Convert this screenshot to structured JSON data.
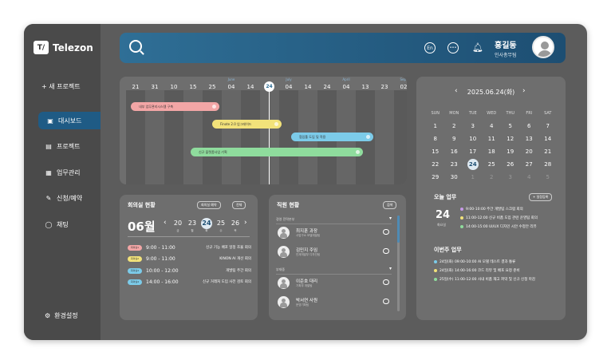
{
  "app": {
    "logo_mark": "T/",
    "name": "Telezon"
  },
  "sidebar": {
    "new_project": "+ 새 프로젝트",
    "items": [
      {
        "icon": "calendar-icon",
        "label": "대시보드",
        "active": true
      },
      {
        "icon": "folder-icon",
        "label": "프로젝트"
      },
      {
        "icon": "briefcase-icon",
        "label": "업무관리"
      },
      {
        "icon": "pencil-icon",
        "label": "신청/예약"
      },
      {
        "icon": "chat-icon",
        "label": "채팅"
      }
    ],
    "settings": "환경설정"
  },
  "topbar": {
    "lang": "En",
    "user_name": "홍길동",
    "user_role": "인사총무팀"
  },
  "gantt": {
    "dates": [
      "21",
      "31",
      "10",
      "15",
      "25",
      "04",
      "14",
      "24",
      "04",
      "14",
      "24",
      "04",
      "13",
      "23",
      "02",
      "12"
    ],
    "months": [
      "",
      "",
      "",
      "",
      "",
      "June",
      "",
      "",
      "July",
      "",
      "",
      "April",
      "",
      "",
      "Sept",
      ""
    ],
    "today_index": 7,
    "bars": [
      {
        "label": "내부 업무관리시스템 구축",
        "color": "#f3a6a6"
      },
      {
        "label": "Finote 2.0 업그레이드",
        "color": "#f2e27a"
      },
      {
        "label": "협업툴 도입 및 적용",
        "color": "#7ccbe9"
      },
      {
        "label": "신규 플랫폼사업 기획",
        "color": "#8fdc9d"
      }
    ]
  },
  "meeting": {
    "title": "회의실 현황",
    "reserve_btn": "회의실 예약",
    "view_btn": "전체",
    "month": "06월",
    "week": [
      {
        "d": "20",
        "w": "금"
      },
      {
        "d": "23",
        "w": "월"
      },
      {
        "d": "24",
        "w": "화"
      },
      {
        "d": "25",
        "w": "수"
      },
      {
        "d": "26",
        "w": "목"
      }
    ],
    "rows": [
      {
        "tag": "회의실1",
        "color": "#f3a6a6",
        "time": "9:00 - 11:00",
        "desc": "신규 기능 배포 일정 조율 회의"
      },
      {
        "tag": "회의실2",
        "color": "#f2e27a",
        "time": "9:00 - 11:00",
        "desc": "KINON AI 개선 회의"
      },
      {
        "tag": "회의실3",
        "color": "#7ccbe9",
        "time": "10:00 - 12:00",
        "desc": "개발팀 주간 회의"
      },
      {
        "tag": "회의실4",
        "color": "#7ccbe9",
        "time": "14:00 - 16:00",
        "desc": "신규 거래처 도입 사전 검토 회의"
      }
    ]
  },
  "employees": {
    "title": "직원 현황",
    "search_btn": "검색",
    "groups": [
      {
        "label": "경영 전략본부"
      },
      {
        "label": "부재중"
      }
    ],
    "members": [
      {
        "name": "최지훈 과장",
        "sub": "사업구소 모델개발팀"
      },
      {
        "name": "김민지 주임",
        "sub": "인재개발부 디자인팀"
      },
      {
        "name": "이준호 대리",
        "sub": "기획부 개발팀"
      },
      {
        "name": "박서연 사원",
        "sub": "운영기획팀"
      }
    ]
  },
  "calendar": {
    "title": "2025.06.24(화)",
    "dow": [
      "SUN",
      "MON",
      "TUE",
      "WED",
      "THU",
      "FRI",
      "SAT"
    ],
    "weeks": [
      [
        "1",
        "2",
        "3",
        "4",
        "5",
        "6",
        "7"
      ],
      [
        "8",
        "9",
        "10",
        "11",
        "12",
        "13",
        "14"
      ],
      [
        "15",
        "16",
        "17",
        "18",
        "19",
        "20",
        "21"
      ],
      [
        "22",
        "23",
        "24",
        "25",
        "26",
        "27",
        "28"
      ],
      [
        "29",
        "30",
        "1",
        "2",
        "3",
        "4",
        "5"
      ]
    ],
    "today": "24"
  },
  "today_tasks": {
    "title": "오늘 업무",
    "add_btn": "+ 일정등록",
    "day": "24",
    "dow": "화요일",
    "items": [
      {
        "color": "#c79ae8",
        "text": "9:00-10:00  주간 개발팀 스크럼 회의"
      },
      {
        "color": "#f2e27a",
        "text": "11:00-12:00  신규 비품 도입 관련 운영팀 회의"
      },
      {
        "color": "#8fdc9d",
        "text": "14:00-15:00  UI/UX 디자인 시안 수정안 리뷰"
      }
    ]
  },
  "week_tasks": {
    "title": "이번주 업무",
    "items": [
      {
        "color": "#7ccbe9",
        "text": "24일(화) 09:00-10:00  AI 모델 테스트 결과 통류"
      },
      {
        "color": "#f2e27a",
        "text": "24일(화) 14:00-16:00  코드 리뷰 및 배포 요청 준비"
      },
      {
        "color": "#8fdc9d",
        "text": "25일(수) 11:00-12:00  사내 비품 재고 파악 및 신규 신청 마감"
      }
    ]
  }
}
